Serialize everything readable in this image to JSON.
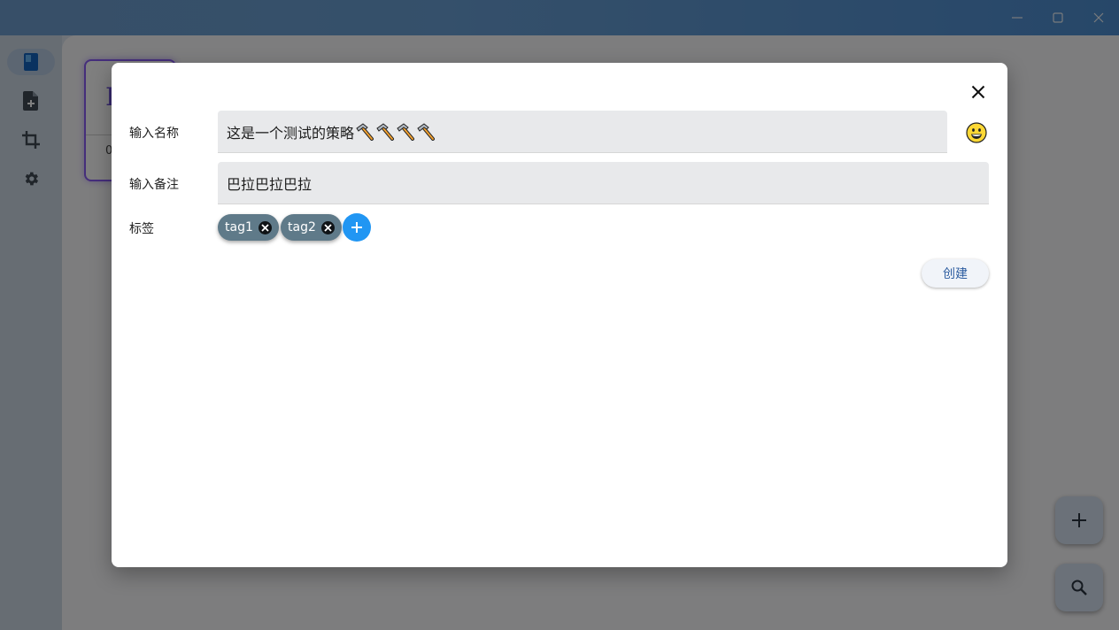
{
  "window": {
    "controls": [
      "minimize-icon",
      "maximize-icon",
      "close-icon"
    ]
  },
  "sidebar": {
    "items": [
      {
        "icon": "book-icon",
        "active": true
      },
      {
        "icon": "add-document-icon",
        "active": false
      },
      {
        "icon": "crop-icon",
        "active": false
      },
      {
        "icon": "gear-icon",
        "active": false
      }
    ]
  },
  "background": {
    "card_glyph": "I",
    "card_footer": "0"
  },
  "dialog": {
    "name_label": "输入名称",
    "name_value": "这是一个测试的策略",
    "name_emoji_count": 4,
    "note_label": "输入备注",
    "note_value": "巴拉巴拉巴拉",
    "tags_label": "标签",
    "tags": [
      "tag1",
      "tag2"
    ],
    "create_label": "创建"
  },
  "fabs": [
    {
      "icon": "plus-icon"
    },
    {
      "icon": "search-icon"
    }
  ],
  "colors": {
    "accent": "#2196f3",
    "chip": "#5f7a89",
    "card_border": "#8a5cf6"
  }
}
